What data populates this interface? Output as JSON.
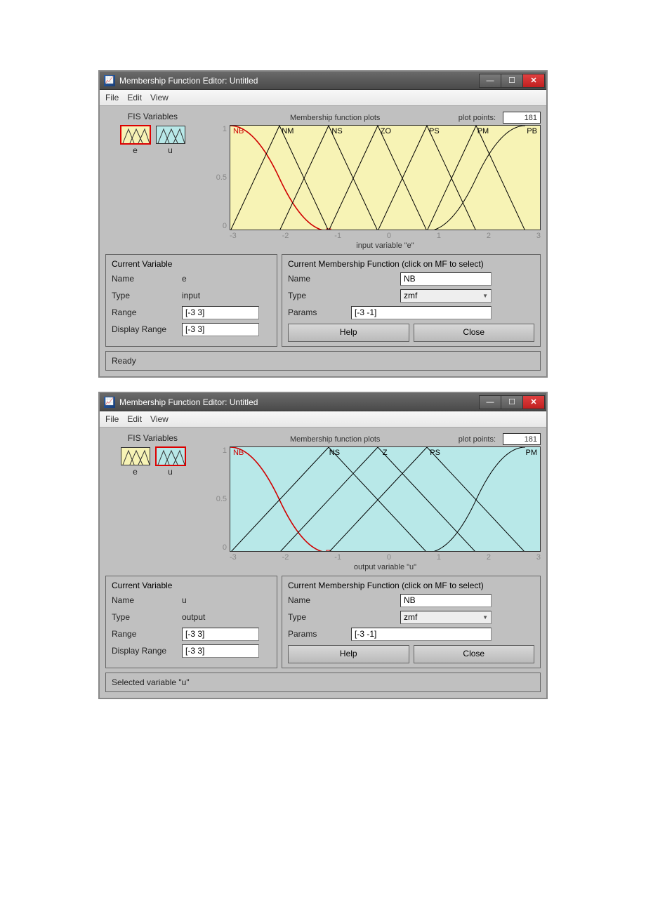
{
  "windows": [
    {
      "title": "Membership Function Editor: Untitled",
      "menu": [
        "File",
        "Edit",
        "View"
      ],
      "fis_title": "FIS Variables",
      "vars": [
        {
          "name": "e",
          "selected": true
        },
        {
          "name": "u",
          "selected": false
        }
      ],
      "plot_points_label": "plot points:",
      "plot_points": "181",
      "plot_title": "Membership function plots",
      "mf_labels": [
        "NB",
        "NM",
        "NS",
        "ZO",
        "PS",
        "PM",
        "PB"
      ],
      "chart_bg": "yellow",
      "xlabel": "input variable \"e\"",
      "yticks": [
        "1",
        "0.5",
        "0"
      ],
      "xticks": [
        "-3",
        "-2",
        "-1",
        "0",
        "1",
        "2",
        "3"
      ],
      "cv": {
        "title": "Current Variable",
        "name_l": "Name",
        "name_v": "e",
        "type_l": "Type",
        "type_v": "input",
        "range_l": "Range",
        "range_v": "[-3 3]",
        "drange_l": "Display Range",
        "drange_v": "[-3 3]"
      },
      "cmf": {
        "title": "Current Membership Function (click on MF to select)",
        "name_l": "Name",
        "name_v": "NB",
        "type_l": "Type",
        "type_v": "zmf",
        "params_l": "Params",
        "params_v": "[-3 -1]"
      },
      "help": "Help",
      "close": "Close",
      "status": "Ready"
    },
    {
      "title": "Membership Function Editor: Untitled",
      "menu": [
        "File",
        "Edit",
        "View"
      ],
      "fis_title": "FIS Variables",
      "vars": [
        {
          "name": "e",
          "selected": false
        },
        {
          "name": "u",
          "selected": true
        }
      ],
      "plot_points_label": "plot points:",
      "plot_points": "181",
      "plot_title": "Membership function plots",
      "mf_labels": [
        "NB",
        "",
        "NS",
        "Z",
        "PS",
        "",
        "PM"
      ],
      "chart_bg": "cyan",
      "xlabel": "output variable \"u\"",
      "yticks": [
        "1",
        "0.5",
        "0"
      ],
      "xticks": [
        "-3",
        "-2",
        "-1",
        "0",
        "1",
        "2",
        "3"
      ],
      "cv": {
        "title": "Current Variable",
        "name_l": "Name",
        "name_v": "u",
        "type_l": "Type",
        "type_v": "output",
        "range_l": "Range",
        "range_v": "[-3 3]",
        "drange_l": "Display Range",
        "drange_v": "[-3 3]"
      },
      "cmf": {
        "title": "Current Membership Function (click on MF to select)",
        "name_l": "Name",
        "name_v": "NB",
        "type_l": "Type",
        "type_v": "zmf",
        "params_l": "Params",
        "params_v": "[-3 -1]"
      },
      "help": "Help",
      "close": "Close",
      "status": "Selected variable \"u\""
    }
  ],
  "chart_data": [
    {
      "type": "line",
      "title": "Membership function plots — input variable \"e\"",
      "xlabel": "input variable \"e\"",
      "ylabel": "",
      "xlim": [
        -3,
        3
      ],
      "ylim": [
        0,
        1
      ],
      "series": [
        {
          "name": "NB",
          "type": "zmf",
          "params": [
            -3,
            -1
          ],
          "x": [
            -3,
            -2,
            -1
          ],
          "y": [
            1,
            0.5,
            0
          ],
          "color": "#d00000",
          "selected": true
        },
        {
          "name": "NM",
          "type": "trimf",
          "x": [
            -3,
            -2,
            -1
          ],
          "y": [
            0,
            1,
            0
          ]
        },
        {
          "name": "NS",
          "type": "trimf",
          "x": [
            -2,
            -1,
            0
          ],
          "y": [
            0,
            1,
            0
          ]
        },
        {
          "name": "ZO",
          "type": "trimf",
          "x": [
            -1,
            0,
            1
          ],
          "y": [
            0,
            1,
            0
          ]
        },
        {
          "name": "PS",
          "type": "trimf",
          "x": [
            0,
            1,
            2
          ],
          "y": [
            0,
            1,
            0
          ]
        },
        {
          "name": "PM",
          "type": "trimf",
          "x": [
            1,
            2,
            3
          ],
          "y": [
            0,
            1,
            0
          ]
        },
        {
          "name": "PB",
          "type": "smf",
          "params": [
            1,
            3
          ],
          "x": [
            1,
            2,
            3
          ],
          "y": [
            0,
            0.5,
            1
          ]
        }
      ]
    },
    {
      "type": "line",
      "title": "Membership function plots — output variable \"u\"",
      "xlabel": "output variable \"u\"",
      "ylabel": "",
      "xlim": [
        -3,
        3
      ],
      "ylim": [
        0,
        1
      ],
      "series": [
        {
          "name": "NB",
          "type": "zmf",
          "params": [
            -3,
            -1
          ],
          "x": [
            -3,
            -2,
            -1
          ],
          "y": [
            1,
            0.5,
            0
          ],
          "color": "#d00000",
          "selected": true
        },
        {
          "name": "NS",
          "type": "trimf",
          "x": [
            -3,
            -1,
            1
          ],
          "y": [
            0,
            1,
            0
          ]
        },
        {
          "name": "Z",
          "type": "trimf",
          "x": [
            -2,
            0,
            2
          ],
          "y": [
            0,
            1,
            0
          ]
        },
        {
          "name": "PS",
          "type": "trimf",
          "x": [
            -1,
            1,
            3
          ],
          "y": [
            0,
            1,
            0
          ]
        },
        {
          "name": "PM",
          "type": "smf",
          "params": [
            1,
            3
          ],
          "x": [
            1,
            2,
            3
          ],
          "y": [
            0,
            0.5,
            1
          ]
        }
      ]
    }
  ]
}
